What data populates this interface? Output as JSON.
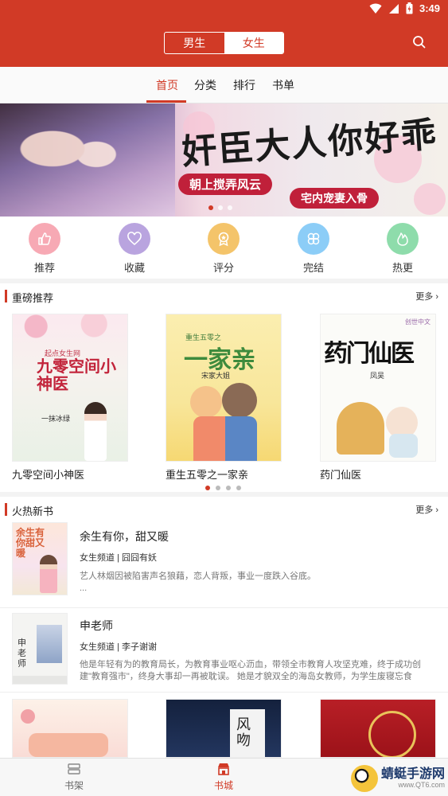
{
  "status_bar": {
    "time": "3:49"
  },
  "header": {
    "gender_tabs": [
      "男生",
      "女生"
    ],
    "selected_gender": "女生"
  },
  "tabs": [
    "首页",
    "分类",
    "排行",
    "书单"
  ],
  "active_tab": "首页",
  "banner": {
    "title": "奸臣大人你好乖",
    "tag1": "朝上搅弄风云",
    "tag2": "宅内宠妻入骨"
  },
  "categories": [
    {
      "label": "推荐",
      "icon": "thumbs-up-icon",
      "color": "#f47a8a"
    },
    {
      "label": "收藏",
      "icon": "heart-icon",
      "color": "#9d7fd0"
    },
    {
      "label": "评分",
      "icon": "medal-icon",
      "color": "#f1b042"
    },
    {
      "label": "完结",
      "icon": "clover-icon",
      "color": "#4fb1f2"
    },
    {
      "label": "热更",
      "icon": "flame-icon",
      "color": "#47c879"
    }
  ],
  "featured": {
    "title": "重磅推荐",
    "more": "更多",
    "books": [
      {
        "name": "九零空间小神医",
        "cover_text": "九零空间小神医",
        "author_on_cover": "一抹冰绿",
        "publisher_on_cover": "起点女生网"
      },
      {
        "name": "重生五零之一家亲",
        "cover_text": "一家亲",
        "author_on_cover": "宋家大姐",
        "publisher_on_cover": "重生五零之"
      },
      {
        "name": "药门仙医",
        "cover_text": "药门仙医",
        "author_on_cover": "凤吴",
        "publisher_on_cover": "创世中文"
      }
    ]
  },
  "new_books": {
    "title": "火热新书",
    "more": "更多",
    "items": [
      {
        "title": "余生有你，甜又暖",
        "channel": "女生频道",
        "author": "囧囧有妖",
        "desc": "艺人林烟因被陷害声名狼藉，恋人背叛，事业一度跌入谷底。",
        "ellipsis": "...",
        "cover_text": "余生有你甜又暖"
      },
      {
        "title": "申老师",
        "channel": "女生频道",
        "author": "李子谢谢",
        "desc": "他是年轻有为的教育局长，为教育事业呕心沥血，带领全市教育人攻坚克难，终于成功创建\"教育强市\"，终身大事却一再被耽误。 她是才貌双全的海岛女教师，为学生废寝忘食",
        "cover_text": "申老师"
      }
    ]
  },
  "more_row_cover_texts": [
    "",
    "风吻",
    ""
  ],
  "bottom_nav": [
    {
      "label": "书架",
      "icon": "bookshelf-icon",
      "active": false
    },
    {
      "label": "书城",
      "icon": "store-icon",
      "active": true
    }
  ],
  "watermark": {
    "name": "蜻蜓手游网",
    "url": "www.QT6.com"
  }
}
